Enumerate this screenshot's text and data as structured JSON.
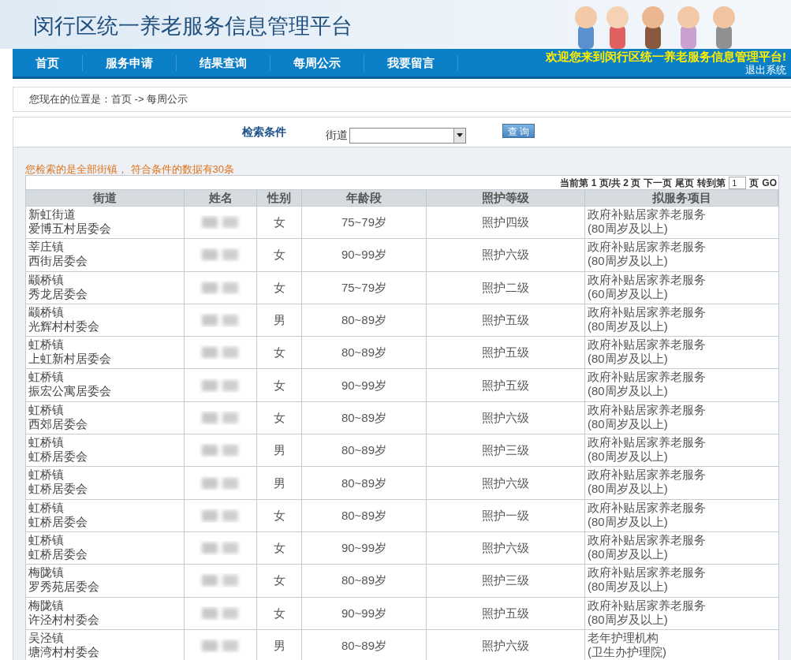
{
  "header": {
    "title": "闵行区统一养老服务信息管理平台"
  },
  "nav": {
    "items": [
      {
        "label": "首页"
      },
      {
        "label": "服务申请"
      },
      {
        "label": "结果查询"
      },
      {
        "label": "每周公示"
      },
      {
        "label": "我要留言"
      }
    ],
    "welcome": "欢迎您来到闵行区统一养老服务信息管理平台!",
    "logout": "退出系统"
  },
  "breadcrumb": "您现在的位置是：首页 -> 每周公示",
  "search": {
    "heading": "检索条件",
    "field_label": "街道",
    "button": "查 询"
  },
  "result_note": "您检索的是全部街镇， 符合条件的数据有30条",
  "pager": {
    "parts": [
      "当前第 1 页/共 2 页",
      "下一页",
      "尾页",
      "转到第"
    ],
    "page_value": "1",
    "page_unit": "页",
    "go": "GO"
  },
  "table": {
    "columns": [
      "街道",
      "姓名",
      "性别",
      "年龄段",
      "照护等级",
      "拟服务项目"
    ],
    "rows": [
      {
        "street": "新虹街道",
        "committee": "爱博五村居委会",
        "name_blurred": true,
        "gender": "女",
        "age": "75~79岁",
        "level": "照护四级",
        "service": "政府补贴居家养老服务",
        "service_note": "(80周岁及以上)"
      },
      {
        "street": "莘庄镇",
        "committee": "西街居委会",
        "name_blurred": true,
        "gender": "女",
        "age": "90~99岁",
        "level": "照护六级",
        "service": "政府补贴居家养老服务",
        "service_note": "(80周岁及以上)"
      },
      {
        "street": "颛桥镇",
        "committee": "秀龙居委会",
        "name_blurred": true,
        "gender": "女",
        "age": "75~79岁",
        "level": "照护二级",
        "service": "政府补贴居家养老服务",
        "service_note": "(60周岁及以上)"
      },
      {
        "street": "颛桥镇",
        "committee": "光辉村村委会",
        "name_blurred": true,
        "gender": "男",
        "age": "80~89岁",
        "level": "照护五级",
        "service": "政府补贴居家养老服务",
        "service_note": "(80周岁及以上)"
      },
      {
        "street": "虹桥镇",
        "committee": "上虹新村居委会",
        "name_blurred": true,
        "gender": "女",
        "age": "80~89岁",
        "level": "照护五级",
        "service": "政府补贴居家养老服务",
        "service_note": "(80周岁及以上)"
      },
      {
        "street": "虹桥镇",
        "committee": "振宏公寓居委会",
        "name_blurred": true,
        "gender": "女",
        "age": "90~99岁",
        "level": "照护五级",
        "service": "政府补贴居家养老服务",
        "service_note": "(80周岁及以上)"
      },
      {
        "street": "虹桥镇",
        "committee": "西郊居委会",
        "name_blurred": true,
        "gender": "女",
        "age": "80~89岁",
        "level": "照护六级",
        "service": "政府补贴居家养老服务",
        "service_note": "(80周岁及以上)"
      },
      {
        "street": "虹桥镇",
        "committee": "虹桥居委会",
        "name_blurred": true,
        "gender": "男",
        "age": "80~89岁",
        "level": "照护三级",
        "service": "政府补贴居家养老服务",
        "service_note": "(80周岁及以上)"
      },
      {
        "street": "虹桥镇",
        "committee": "虹桥居委会",
        "name_blurred": true,
        "gender": "男",
        "age": "80~89岁",
        "level": "照护六级",
        "service": "政府补贴居家养老服务",
        "service_note": "(80周岁及以上)"
      },
      {
        "street": "虹桥镇",
        "committee": "虹桥居委会",
        "name_blurred": true,
        "gender": "女",
        "age": "80~89岁",
        "level": "照护一级",
        "service": "政府补贴居家养老服务",
        "service_note": "(80周岁及以上)"
      },
      {
        "street": "虹桥镇",
        "committee": "虹桥居委会",
        "name_blurred": true,
        "gender": "女",
        "age": "90~99岁",
        "level": "照护六级",
        "service": "政府补贴居家养老服务",
        "service_note": "(80周岁及以上)"
      },
      {
        "street": "梅陇镇",
        "committee": "罗秀苑居委会",
        "name_blurred": true,
        "gender": "女",
        "age": "80~89岁",
        "level": "照护三级",
        "service": "政府补贴居家养老服务",
        "service_note": "(80周岁及以上)"
      },
      {
        "street": "梅陇镇",
        "committee": "许泾村村委会",
        "name_blurred": true,
        "gender": "女",
        "age": "90~99岁",
        "level": "照护五级",
        "service": "政府补贴居家养老服务",
        "service_note": "(80周岁及以上)"
      },
      {
        "street": "吴泾镇",
        "committee": "塘湾村村委会",
        "name_blurred": true,
        "gender": "男",
        "age": "80~89岁",
        "level": "照护六级",
        "service": "老年护理机构",
        "service_note": "(卫生办护理院)"
      }
    ]
  }
}
